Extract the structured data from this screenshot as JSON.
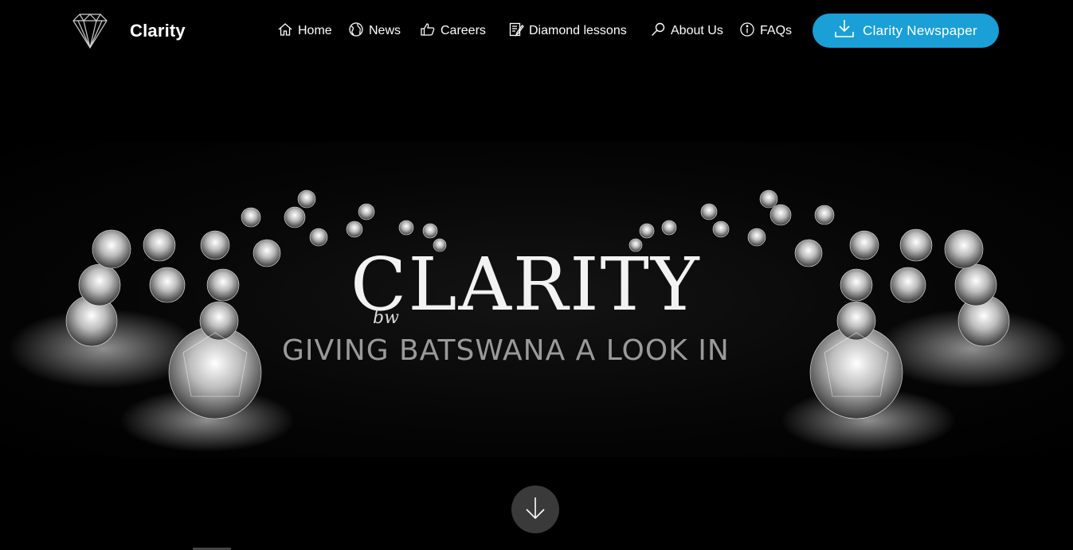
{
  "header": {
    "brand": "Clarity",
    "logo_icon": "diamond-icon",
    "nav": [
      {
        "label": "Home",
        "icon": "home-icon"
      },
      {
        "label": "News",
        "icon": "globe-icon"
      },
      {
        "label": "Careers",
        "icon": "thumbs-up-icon"
      },
      {
        "label": "Diamond lessons",
        "icon": "edit-document-icon"
      },
      {
        "label": "About Us",
        "icon": "search-icon"
      },
      {
        "label": "FAQs",
        "icon": "info-icon"
      }
    ],
    "cta": {
      "label": "Clarity Newspaper",
      "icon": "download-icon",
      "color": "#1a9fd6"
    }
  },
  "hero": {
    "title": "CLARITY",
    "title_prefix": "bw",
    "subtitle": "GIVING BATSWANA A LOOK IN"
  },
  "scroll_button": {
    "icon": "arrow-down-icon"
  }
}
